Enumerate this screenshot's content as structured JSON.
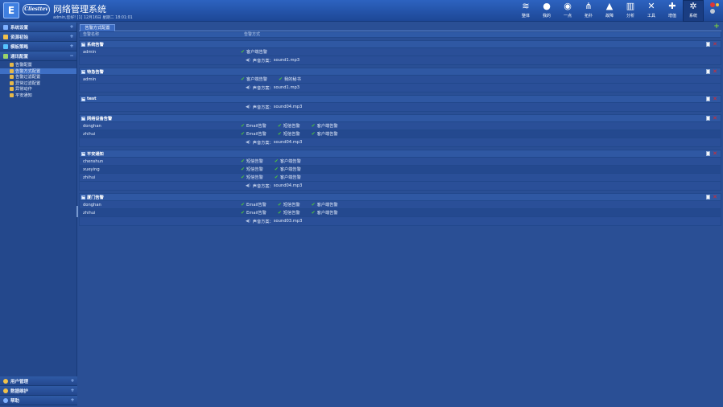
{
  "header": {
    "logo_char": "E",
    "brand": "Cliesttev",
    "title": "网络管理系统",
    "user_info": "admin,您好! [1] 12月16日 星期二 18:01:01"
  },
  "nav": [
    {
      "label": "整体",
      "icon": "layers-icon",
      "glyph": "≋"
    },
    {
      "label": "我的",
      "icon": "user-icon",
      "glyph": "●"
    },
    {
      "label": "一点",
      "icon": "dots-icon",
      "glyph": "◉"
    },
    {
      "label": "拓扑",
      "icon": "topology-icon",
      "glyph": "⋔"
    },
    {
      "label": "故障",
      "icon": "warning-icon",
      "glyph": "▲"
    },
    {
      "label": "分析",
      "icon": "chart-icon",
      "glyph": "▥"
    },
    {
      "label": "工具",
      "icon": "tools-icon",
      "glyph": "✕"
    },
    {
      "label": "增值",
      "icon": "plus-icon",
      "glyph": "✚"
    },
    {
      "label": "系统",
      "icon": "gear-icon",
      "glyph": "✲"
    }
  ],
  "sidebar": {
    "sections": [
      {
        "label": "系统设置",
        "toggle": "+"
      },
      {
        "label": "资源初始",
        "toggle": "+"
      },
      {
        "label": "模板策略",
        "toggle": "+"
      },
      {
        "label": "通讯配置",
        "toggle": "−"
      }
    ],
    "items": [
      {
        "label": "告警配置",
        "active": false
      },
      {
        "label": "告警方式配置",
        "active": true
      },
      {
        "label": "告警过滤配置",
        "active": false
      },
      {
        "label": "异常过滤配置",
        "active": false
      },
      {
        "label": "异常动作",
        "active": false
      },
      {
        "label": "平安通知",
        "active": false
      }
    ],
    "bottom": [
      {
        "label": "用户管理",
        "toggle": "+"
      },
      {
        "label": "数据维护",
        "toggle": "+"
      },
      {
        "label": "帮助",
        "toggle": "+"
      }
    ]
  },
  "main": {
    "tab": "告警方式配置",
    "add_symbol": "+",
    "columns": [
      "告警名称",
      "告警方式"
    ],
    "sound_prefix": "声音方案：",
    "groups": [
      {
        "name": "系统告警",
        "rows": [
          {
            "user": "admin",
            "methods": [
              "客户端告警"
            ]
          }
        ],
        "sound": "sound1.mp3"
      },
      {
        "name": "特急告警",
        "rows": [
          {
            "user": "admin",
            "methods": [
              "客户端告警",
              "我的秘书"
            ]
          }
        ],
        "sound": "sound1.mp3"
      },
      {
        "name": "test",
        "rows": [],
        "sound": "sound04.mp3"
      },
      {
        "name": "网络设备告警",
        "rows": [
          {
            "user": "donghan",
            "methods": [
              "Email告警",
              "短信告警",
              "客户端告警"
            ]
          },
          {
            "user": "zhihui",
            "methods": [
              "Email告警",
              "短信告警",
              "客户端告警"
            ]
          }
        ],
        "sound": "sound04.mp3"
      },
      {
        "name": "平安通知",
        "rows": [
          {
            "user": "chenshun",
            "methods": [
              "短信告警",
              "客户端告警"
            ]
          },
          {
            "user": "xueying",
            "methods": [
              "短信告警",
              "客户端告警"
            ]
          },
          {
            "user": "zhihui",
            "methods": [
              "短信告警",
              "客户端告警"
            ]
          }
        ],
        "sound": "sound04.mp3"
      },
      {
        "name": "厦门告警",
        "rows": [
          {
            "user": "donghan",
            "methods": [
              "Email告警",
              "短信告警",
              "客户端告警"
            ]
          },
          {
            "user": "zhihui",
            "methods": [
              "Email告警",
              "短信告警",
              "客户端告警"
            ]
          }
        ],
        "sound": "sound03.mp3"
      }
    ]
  }
}
